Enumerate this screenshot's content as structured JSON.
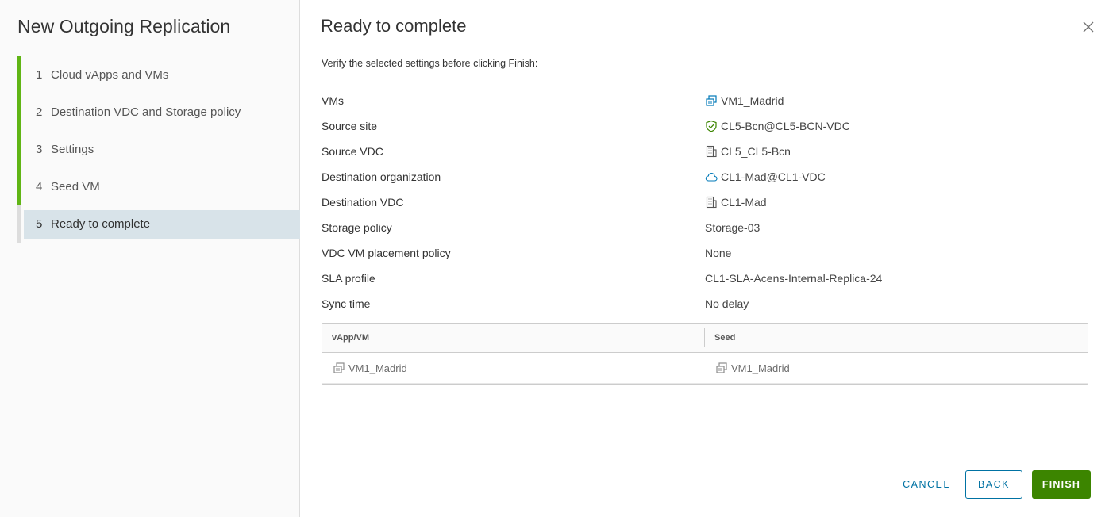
{
  "wizard": {
    "title": "New Outgoing Replication",
    "steps": [
      {
        "num": "1",
        "label": "Cloud vApps and VMs",
        "state": "completed"
      },
      {
        "num": "2",
        "label": "Destination VDC and Storage policy",
        "state": "completed"
      },
      {
        "num": "3",
        "label": "Settings",
        "state": "completed"
      },
      {
        "num": "4",
        "label": "Seed VM",
        "state": "completed"
      },
      {
        "num": "5",
        "label": "Ready to complete",
        "state": "current"
      }
    ]
  },
  "page": {
    "title": "Ready to complete",
    "instructions": "Verify the selected settings before clicking Finish:"
  },
  "summary": [
    {
      "label": "VMs",
      "value": "VM1_Madrid",
      "icon": "vm-icon"
    },
    {
      "label": "Source site",
      "value": "CL5-Bcn@CL5-BCN-VDC",
      "icon": "shield-check-icon"
    },
    {
      "label": "Source VDC",
      "value": "CL5_CL5-Bcn",
      "icon": "building-icon"
    },
    {
      "label": "Destination organization",
      "value": "CL1-Mad@CL1-VDC",
      "icon": "cloud-icon"
    },
    {
      "label": "Destination VDC",
      "value": "CL1-Mad",
      "icon": "building-icon"
    },
    {
      "label": "Storage policy",
      "value": "Storage-03",
      "icon": ""
    },
    {
      "label": "VDC VM placement policy",
      "value": "None",
      "icon": ""
    },
    {
      "label": "SLA profile",
      "value": "CL1-SLA-Acens-Internal-Replica-24",
      "icon": ""
    },
    {
      "label": "Sync time",
      "value": "No delay",
      "icon": ""
    }
  ],
  "grid": {
    "columns": [
      "vApp/VM",
      "Seed"
    ],
    "rows": [
      {
        "vapp_vm": "VM1_Madrid",
        "seed": "VM1_Madrid"
      }
    ]
  },
  "footer": {
    "cancel_label": "CANCEL",
    "back_label": "BACK",
    "finish_label": "FINISH"
  },
  "colors": {
    "accent_blue": "#0072a3",
    "finish_green": "#3c8500",
    "step_complete": "#60b515",
    "current_step_bg": "#d8e3e9"
  }
}
